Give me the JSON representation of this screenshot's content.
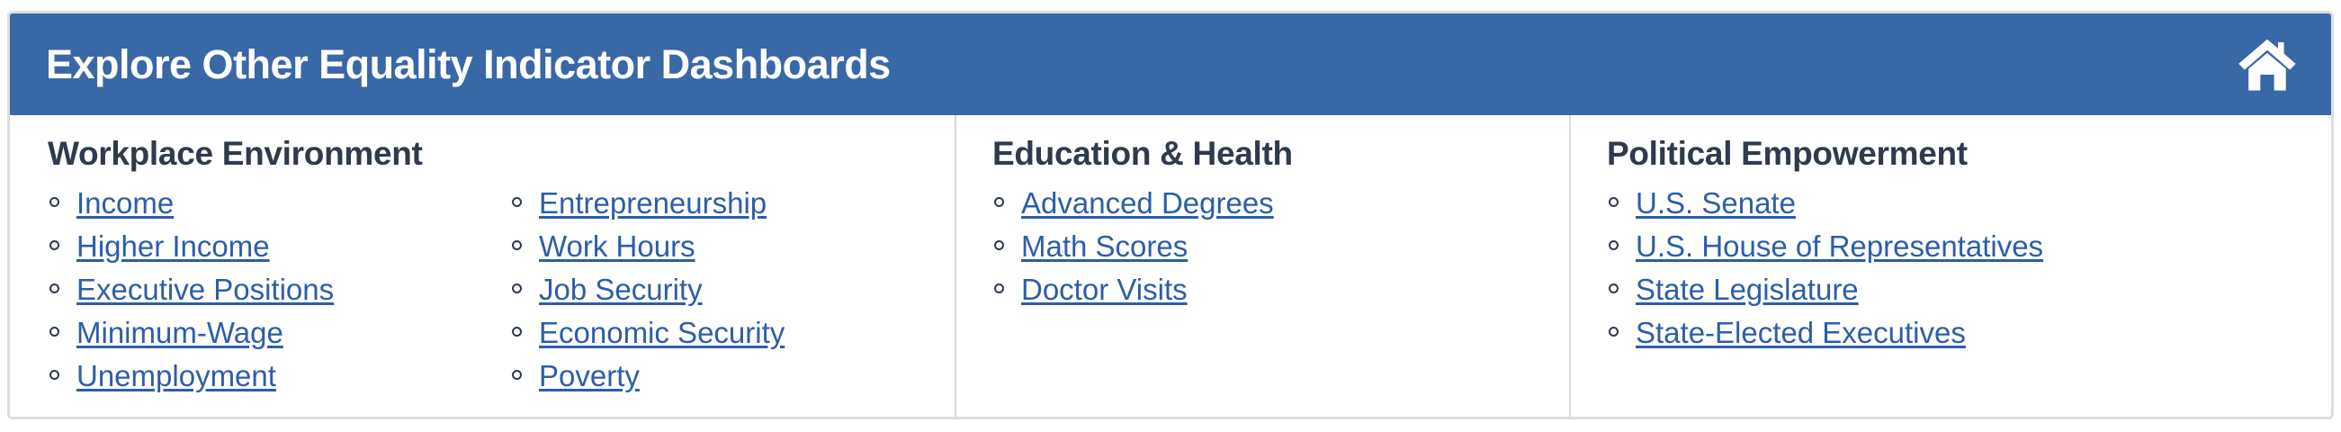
{
  "header": {
    "title": "Explore Other Equality Indicator Dashboards",
    "home_icon": "home-icon"
  },
  "colors": {
    "header_bg": "#3868a5",
    "link": "#2c5ea8",
    "heading": "#2f3a4c"
  },
  "sections": {
    "workplace": {
      "heading": "Workplace Environment",
      "links_a": [
        "Income",
        "Higher Income",
        "Executive Positions",
        "Minimum-Wage",
        "Unemployment"
      ],
      "links_b": [
        "Entrepreneurship",
        "Work Hours",
        "Job Security",
        "Economic Security",
        "Poverty"
      ]
    },
    "education": {
      "heading": "Education & Health",
      "links": [
        "Advanced Degrees",
        "Math Scores",
        "Doctor Visits"
      ]
    },
    "political": {
      "heading": "Political Empowerment",
      "links": [
        "U.S. Senate",
        "U.S. House of Representatives",
        "State Legislature",
        "State-Elected Executives"
      ]
    }
  }
}
